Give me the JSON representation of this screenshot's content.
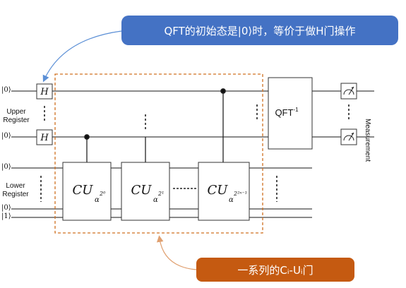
{
  "callouts": {
    "top_text": "QFT的初始态是|0⟩时，等价于做H门操作",
    "bottom_text": "一系列的Cᵢ-Uᵢ门"
  },
  "registers": {
    "upper_label": "Upper\nRegister",
    "lower_label": "Lower\nRegister",
    "kets": [
      "|0⟩",
      "|0⟩",
      "|0⟩",
      "|0⟩",
      "|1⟩"
    ]
  },
  "gates": {
    "hadamard": "H",
    "qft_label": "QFT",
    "qft_superscript": "-1",
    "cu_base": "CU",
    "cu_subscript": "α",
    "cu_exponents": [
      "2⁰",
      "2¹",
      "2²ⁿ⁻¹"
    ],
    "measurement_label": "Measurement"
  },
  "colors": {
    "callout_blue": "#4472c4",
    "callout_orange": "#c55a11",
    "dashed_box": "#d07020",
    "arrow_blue": "#5b8fd6",
    "arrow_orange": "#e0a070"
  }
}
